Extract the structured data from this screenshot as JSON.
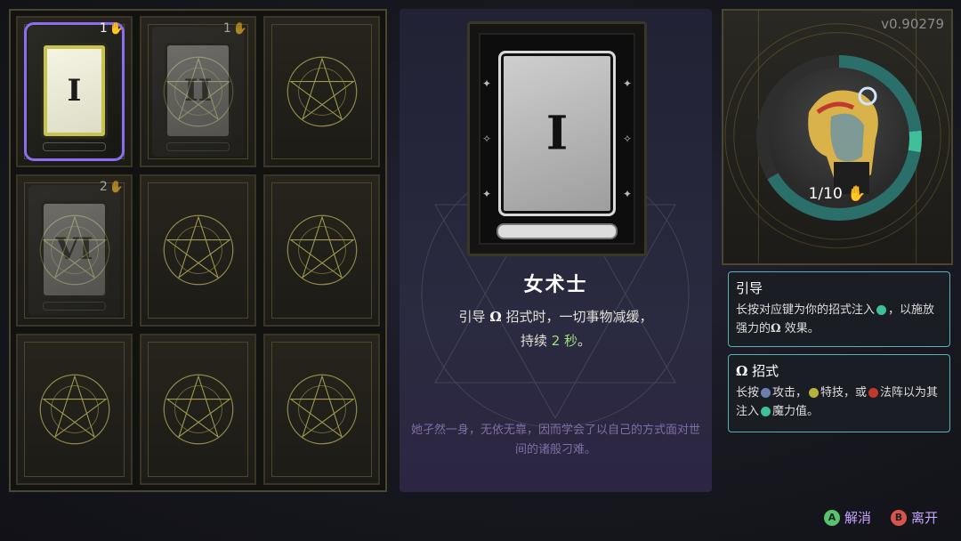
{
  "version": "v0.90279",
  "grid": {
    "cards": [
      {
        "numeral": "I",
        "rank": "1",
        "state": "selected"
      },
      {
        "numeral": "II",
        "rank": "1",
        "state": "dim"
      },
      {
        "numeral": "",
        "rank": "",
        "state": "empty"
      },
      {
        "numeral": "VI",
        "rank": "2",
        "state": "dim"
      },
      {
        "numeral": "",
        "rank": "",
        "state": "empty"
      },
      {
        "numeral": "",
        "rank": "",
        "state": "empty"
      },
      {
        "numeral": "",
        "rank": "",
        "state": "empty"
      },
      {
        "numeral": "",
        "rank": "",
        "state": "empty"
      },
      {
        "numeral": "",
        "rank": "",
        "state": "empty"
      }
    ]
  },
  "detail": {
    "numeral": "I",
    "name": "女术士",
    "desc_1": "引导",
    "desc_omega": "Ω",
    "desc_2": "招式时，一切事物减缓，",
    "desc_3": "持续",
    "desc_value": "2 秒",
    "desc_4": "。",
    "flavor": "她孑然一身，无依无靠，因而学会了以自己的方式面对世间的诸般刁难。"
  },
  "portrait": {
    "count": "1/10"
  },
  "info": [
    {
      "title": "引导",
      "text_1": "长按对应键为你的招式注入",
      "text_2": "，以施放强力的",
      "omega": "Ω",
      "text_3": "效果。"
    },
    {
      "title_omega": "Ω",
      "title": "招式",
      "text_1": "长按",
      "text_2": "攻击，",
      "text_3": "特技，或",
      "text_4": "法阵以为其注入",
      "text_5": "魔力值。"
    }
  ],
  "actions": {
    "cancel_key": "A",
    "cancel_label": "解消",
    "leave_key": "B",
    "leave_label": "离开"
  },
  "colors": {
    "accent_purple": "#8b6df2",
    "teal": "#3fbf9a",
    "highlight_green": "#9fe07c",
    "action_text": "#c7a5ff"
  }
}
